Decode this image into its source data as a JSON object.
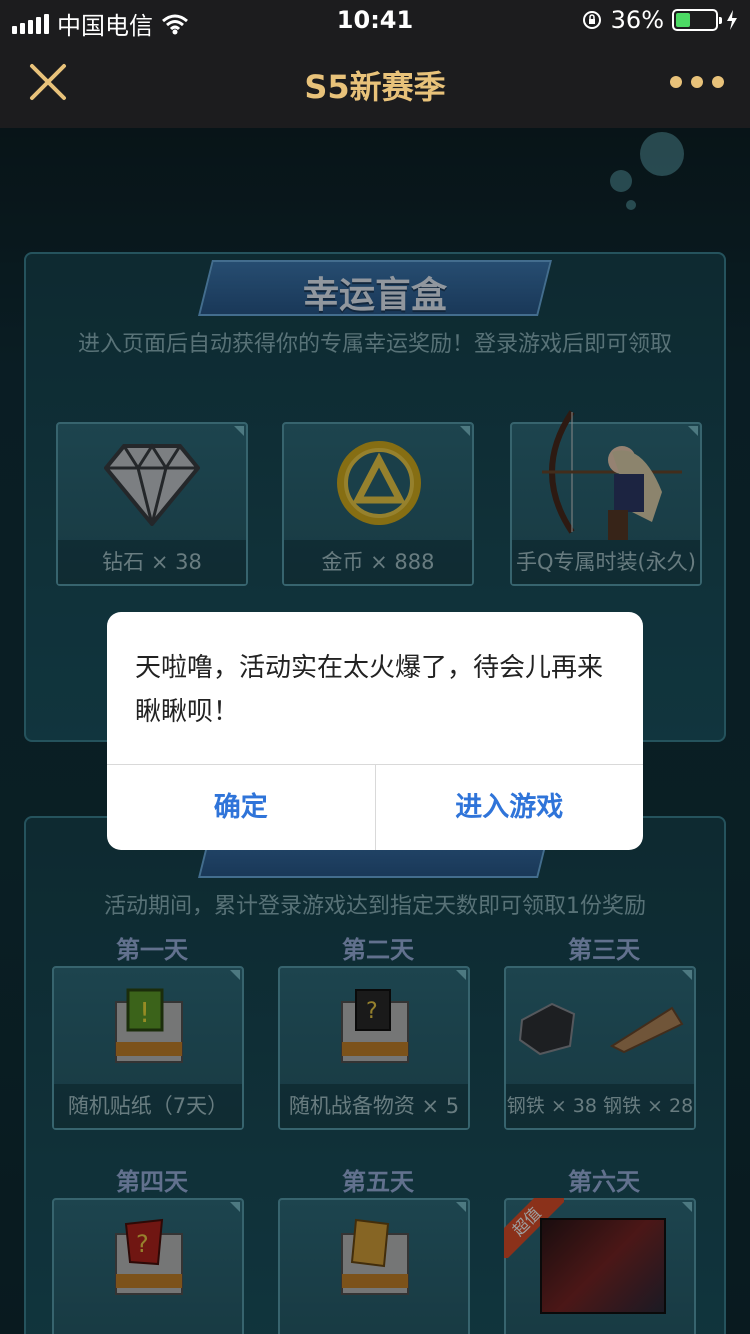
{
  "status_bar": {
    "carrier": "中国电信",
    "time": "10:41",
    "battery_percent": "36%",
    "battery_level": 0.36
  },
  "nav": {
    "title": "S5新赛季",
    "close_icon": "close-icon",
    "more_icon": "more-icon"
  },
  "lucky_box": {
    "title": "幸运盲盒",
    "subtitle": "进入页面后自动获得你的专属幸运奖励！登录游戏后即可领取",
    "rewards": [
      {
        "label": "钻石 × 38",
        "icon": "diamond-icon"
      },
      {
        "label": "金币 × 888",
        "icon": "coin-icon"
      },
      {
        "label": "手Q专属时装(永久)",
        "icon": "archer-costume-icon"
      }
    ]
  },
  "checkin": {
    "subtitle": "活动期间，累计登录游戏达到指定天数即可领取1份奖励",
    "days": [
      {
        "day": "第一天",
        "label": "随机贴纸（7天）"
      },
      {
        "day": "第二天",
        "label": "随机战备物资 × 5"
      },
      {
        "day": "第三天",
        "label": "钢铁 × 38   钢铁 × 28"
      },
      {
        "day": "第四天",
        "label": ""
      },
      {
        "day": "第五天",
        "label": ""
      },
      {
        "day": "第六天",
        "label": "",
        "badge": "超值"
      }
    ]
  },
  "dialog": {
    "message": "天啦噜，活动实在太火爆了，待会儿再来瞅瞅呗！",
    "confirm": "确定",
    "enter_game": "进入游戏"
  },
  "colors": {
    "nav_accent": "#e8c27a",
    "dialog_button": "#2f74d9"
  }
}
